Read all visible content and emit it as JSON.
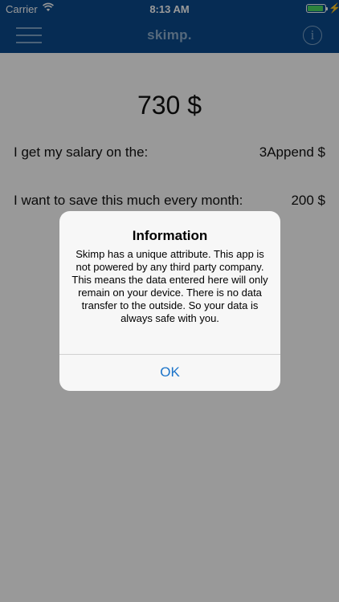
{
  "status_bar": {
    "carrier": "Carrier",
    "time": "8:13 AM",
    "charging_glyph": "⚡",
    "battery_level": 0.9
  },
  "nav": {
    "title": "skimp.",
    "info_glyph": "i",
    "menu_icon": "hamburger-icon",
    "info_icon": "info-icon"
  },
  "main": {
    "amount": "730 $",
    "salary_label": "I get my salary on the:",
    "salary_value": "3Append $",
    "save_label": "I want to save this much every month:",
    "save_value": "200 $"
  },
  "alert": {
    "title": "Information",
    "message": "Skimp has a unique attribute. This app is not powered by any third party company. This means the data entered here will only remain on your device. There is no data transfer to the outside. So your data is always safe with you.",
    "ok_label": "OK"
  },
  "colors": {
    "nav_background": "#0a4a8c",
    "accent": "#1a73c9",
    "battery": "#4cd964"
  }
}
